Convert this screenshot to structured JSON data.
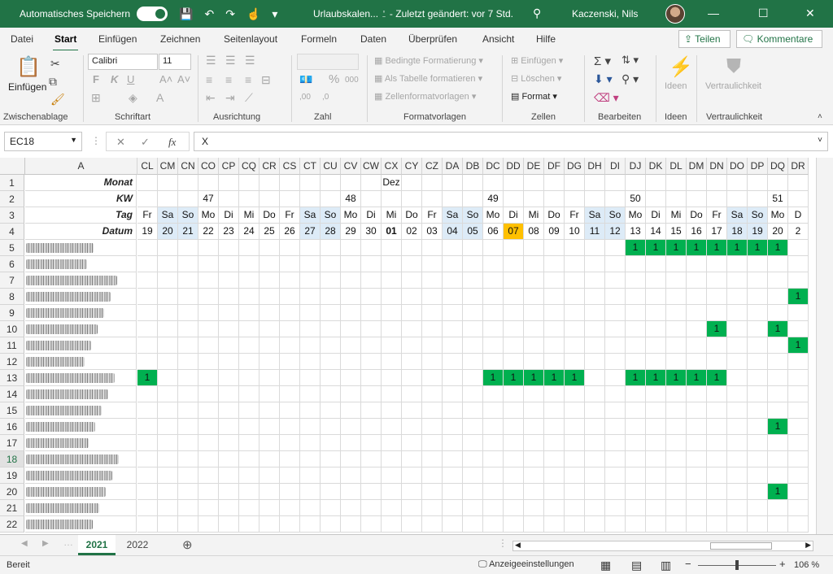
{
  "titlebar": {
    "autosave_label": "Automatisches Speichern",
    "doc_title": "Urlaubskalen... ⍘ - Zuletzt geändert: vor 7 Std.",
    "user": "Kaczenski, Nils"
  },
  "ribbon_tabs": [
    "Datei",
    "Start",
    "Einfügen",
    "Zeichnen",
    "Seitenlayout",
    "Formeln",
    "Daten",
    "Überprüfen",
    "Ansicht",
    "Hilfe"
  ],
  "share_label": "Teilen",
  "comment_label": "Kommentare",
  "ribbon": {
    "paste_label": "Einfügen",
    "font_name": "Calibri",
    "font_size": "11",
    "groups": [
      "Zwischenablage",
      "Schriftart",
      "Ausrichtung",
      "Zahl",
      "Formatvorlagen",
      "Zellen",
      "Bearbeiten",
      "Ideen",
      "Vertraulichkeit"
    ],
    "styles": [
      "Bedingte Formatierung",
      "Als Tabelle formatieren",
      "Zellenformatvorlagen"
    ],
    "cells": [
      "Einfügen",
      "Löschen",
      "Format"
    ],
    "ideas_label": "Ideen",
    "sensitivity_label": "Vertraulichkeit"
  },
  "formula_bar": {
    "name_box": "EC18",
    "formula": "X",
    "fx": "fx"
  },
  "grid": {
    "col_a": "A",
    "columns": [
      "CL",
      "CM",
      "CN",
      "CO",
      "CP",
      "CQ",
      "CR",
      "CS",
      "CT",
      "CU",
      "CV",
      "CW",
      "CX",
      "CY",
      "CZ",
      "DA",
      "DB",
      "DC",
      "DD",
      "DE",
      "DF",
      "DG",
      "DH",
      "DI",
      "DJ",
      "DK",
      "DL",
      "DM",
      "DN",
      "DO",
      "DP",
      "DQ",
      "DR"
    ],
    "row_labels": [
      "Monat",
      "KW",
      "Tag",
      "Datum"
    ],
    "month_row": {
      "CX": "Dez"
    },
    "kw_row": {
      "CO": "47",
      "CV": "48",
      "DC": "49",
      "DJ": "50",
      "DQ": "51"
    },
    "days": [
      "Fr",
      "Sa",
      "So",
      "Mo",
      "Di",
      "Mi",
      "Do",
      "Fr",
      "Sa",
      "So",
      "Mo",
      "Di",
      "Mi",
      "Do",
      "Fr",
      "Sa",
      "So",
      "Mo",
      "Di",
      "Mi",
      "Do",
      "Fr",
      "Sa",
      "So",
      "Mo",
      "Di",
      "Mi",
      "Do",
      "Fr",
      "Sa",
      "So",
      "Mo",
      "D"
    ],
    "dates": [
      "19",
      "20",
      "21",
      "22",
      "23",
      "24",
      "25",
      "26",
      "27",
      "28",
      "29",
      "30",
      "01",
      "02",
      "03",
      "04",
      "05",
      "06",
      "07",
      "08",
      "09",
      "10",
      "11",
      "12",
      "13",
      "14",
      "15",
      "16",
      "17",
      "18",
      "19",
      "20",
      "2"
    ],
    "row_numbers": [
      "1",
      "2",
      "3",
      "4",
      "5",
      "6",
      "7",
      "8",
      "9",
      "10",
      "11",
      "12",
      "13",
      "14",
      "15",
      "16",
      "17",
      "18",
      "19",
      "20",
      "21",
      "22"
    ],
    "selected_row": "18",
    "vacation_value": "1",
    "vacations": {
      "5": [
        "DJ",
        "DK",
        "DL",
        "DM",
        "DN",
        "DO",
        "DP",
        "DQ"
      ],
      "8": [
        "DR"
      ],
      "10": [
        "DN",
        "DQ"
      ],
      "11": [
        "DR"
      ],
      "13": [
        "CL",
        "DC",
        "DD",
        "DE",
        "DF",
        "DG",
        "DJ",
        "DK",
        "DL",
        "DM",
        "DN"
      ],
      "16": [
        "DQ"
      ],
      "20": [
        "DQ"
      ]
    }
  },
  "sheets": [
    "2021",
    "2022"
  ],
  "statusbar": {
    "ready": "Bereit",
    "display_settings": "Anzeigeeinstellungen",
    "zoom": "106 %"
  }
}
